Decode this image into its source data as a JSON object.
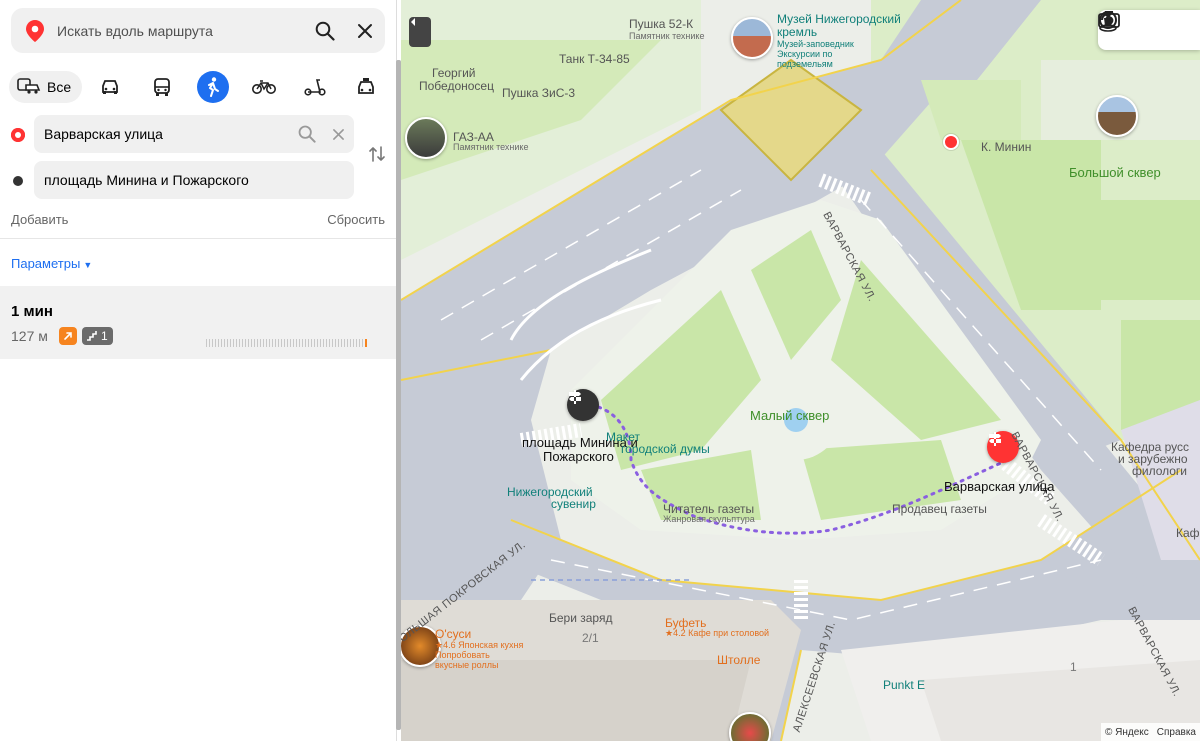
{
  "search": {
    "placeholder": "Искать вдоль маршрута"
  },
  "modes": {
    "all_label": "Все",
    "items": [
      "car",
      "bus",
      "pedestrian",
      "bicycle",
      "scooter",
      "taxi"
    ],
    "active": "pedestrian"
  },
  "route": {
    "from": "Варварская улица",
    "to": "площадь Минина и Пожарского"
  },
  "actions": {
    "add_label": "Добавить",
    "reset_label": "Сбросить"
  },
  "params_label": "Параметры",
  "result": {
    "time": "1 мин",
    "distance": "127 м",
    "stairs_count": "1"
  },
  "map": {
    "labels": {
      "pushka52k": "Пушка 52-К",
      "pamyatnik_tehniki_1": "Памятник технике",
      "tank": "Танк Т-34-85",
      "georgiy_1": "Георгий",
      "georgiy_2": "Победоносец",
      "pushka_zis": "Пушка ЗиС-3",
      "gaz": "ГАЗ-АА",
      "pamyatnik_tehniki_2": "Памятник технике",
      "museum_1": "Музей Нижегородский",
      "museum_2": "кремль",
      "museum_sub_1": "Музей-заповедник",
      "museum_sub_2": "Экскурсии по",
      "museum_sub_3": "подземельям",
      "k_minin": "К. Минин",
      "bolshoy_skver": "Большой сквер",
      "malyy_skver": "Малый сквер",
      "varvarskaya_ul_1": "ВАРВАРСКАЯ УЛ.",
      "varvarskaya_ul_2": "ВАРВАРСКАЯ УЛ.",
      "varvarskaya_ul_3": "ВАРВАРСКАЯ УЛ.",
      "ploshchad_1": "площадь Минина и",
      "ploshchad_2": "Пожарского",
      "maket": "Макет",
      "duma": "городской думы",
      "suvenir_1": "Нижегородский",
      "suvenir_2": "сувенир",
      "chitatel": "Читатель газеты",
      "chitatel_sub": "Жанровая скульптура",
      "prodavec": "Продавец газеты",
      "varvarskaya_end": "Варварская улица",
      "kafedra_1": "Кафедра русс",
      "kafedra_2": "и зарубежно",
      "kafedra_3": "филологи",
      "kaf_small": "Каф",
      "pokrovskaya": "БОЛЬШАЯ ПОКРОВСКАЯ УЛ.",
      "alekseevskaya": "АЛЕКСЕЕВСКАЯ УЛ.",
      "beri_zaryad": "Бери заряд",
      "num_2_1": "2/1",
      "osushi": "О'суси",
      "osushi_sub_1": "★4.6 Японская кухня",
      "osushi_sub_2": "Попробовать",
      "osushi_sub_3": "вкусные роллы",
      "bufet": "Буфеть",
      "bufet_sub": "★4.2 Кафе при столовой",
      "shtolle": "Штолле",
      "punkt_e": "Punkt E",
      "num_1": "1"
    },
    "copyright": "© Яндекс",
    "help": "Справка"
  }
}
